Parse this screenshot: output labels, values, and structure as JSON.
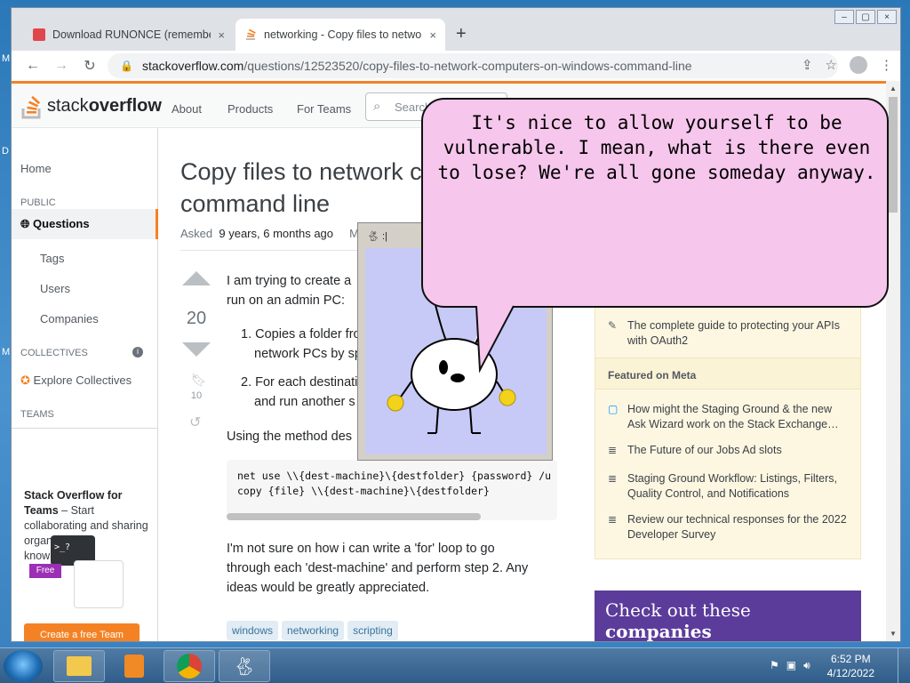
{
  "browser": {
    "tabs": [
      {
        "title": "Download RUNONCE (remembe…",
        "close": "×"
      },
      {
        "title": "networking - Copy files to netwo…",
        "close": "×"
      }
    ],
    "new_tab": "+",
    "url_host": "stackoverflow.com",
    "url_path": "/questions/12523520/copy-files-to-network-computers-on-windows-command-line",
    "window_controls": [
      "–",
      "▢",
      "×"
    ]
  },
  "so": {
    "logo_text_light": "stack",
    "logo_text_bold": "overflow",
    "nav": [
      "About",
      "Products",
      "For Teams"
    ],
    "search_placeholder": "Search…"
  },
  "leftnav": {
    "home": "Home",
    "public": "PUBLIC",
    "questions": "Questions",
    "tags": "Tags",
    "users": "Users",
    "companies": "Companies",
    "collectives": "COLLECTIVES",
    "explore_collectives": "Explore Collectives",
    "teams": "TEAMS",
    "teams_title": "Stack Overflow for Teams",
    "teams_desc": "– Start collaborating and sharing organizational knowledge.",
    "free_badge": "Free",
    "create_team": "Create a free Team"
  },
  "question": {
    "title": "Copy files to network c… command line",
    "title_line1": "Copy files to network c",
    "title_line2": "command line",
    "asked_label": "Asked",
    "asked_value": "9 years, 6 months ago",
    "modified_label": "Mo",
    "score": "20",
    "bookmarks": "10",
    "p1_line1": "I am trying to create a",
    "p1_line2": "run on an admin PC:",
    "li1_line1": "1. Copies a folder fro",
    "li1_line2": "network PCs by sp",
    "li2_line1": "2. For each destinati",
    "li2_line2": "and run another s",
    "p2": "Using the method des",
    "code_line1": "net use \\\\{dest-machine}\\{destfolder} {password} /u",
    "code_line2": "copy {file} \\\\{dest-machine}\\{destfolder}",
    "p3_line1": "I'm not sure on how i can write a 'for' loop to go",
    "p3_line2": "through each 'dest-machine' and perform step 2. Any",
    "p3_line3": "ideas would be greatly appreciated.",
    "tags": [
      "windows",
      "networking",
      "scripting"
    ]
  },
  "sidebar": {
    "blog_item": "The complete guide to protecting your APIs with OAuth2",
    "meta_header": "Featured on Meta",
    "meta_items": [
      "How might the Staging Ground & the new Ask Wizard work on the Stack Exchange…",
      "The Future of our Jobs Ad slots",
      "Staging Ground Workflow: Listings, Filters, Quality Control, and Notifications",
      "Review our technical responses for the 2022 Developer Survey"
    ],
    "companies_light": "Check out these ",
    "companies_bold": "companies"
  },
  "pet": {
    "title": ":|",
    "bubble": "It's nice to allow yourself to be vulnerable. I mean, what is there even to lose? We're all gone someday anyway."
  },
  "taskbar": {
    "time": "6:52 PM",
    "date": "4/12/2022"
  },
  "colors": {
    "so_orange": "#f48225",
    "bubble_pink": "#f6c6ec",
    "pet_bg": "#c7c9f6",
    "companies_purple": "#5b3c9b"
  }
}
